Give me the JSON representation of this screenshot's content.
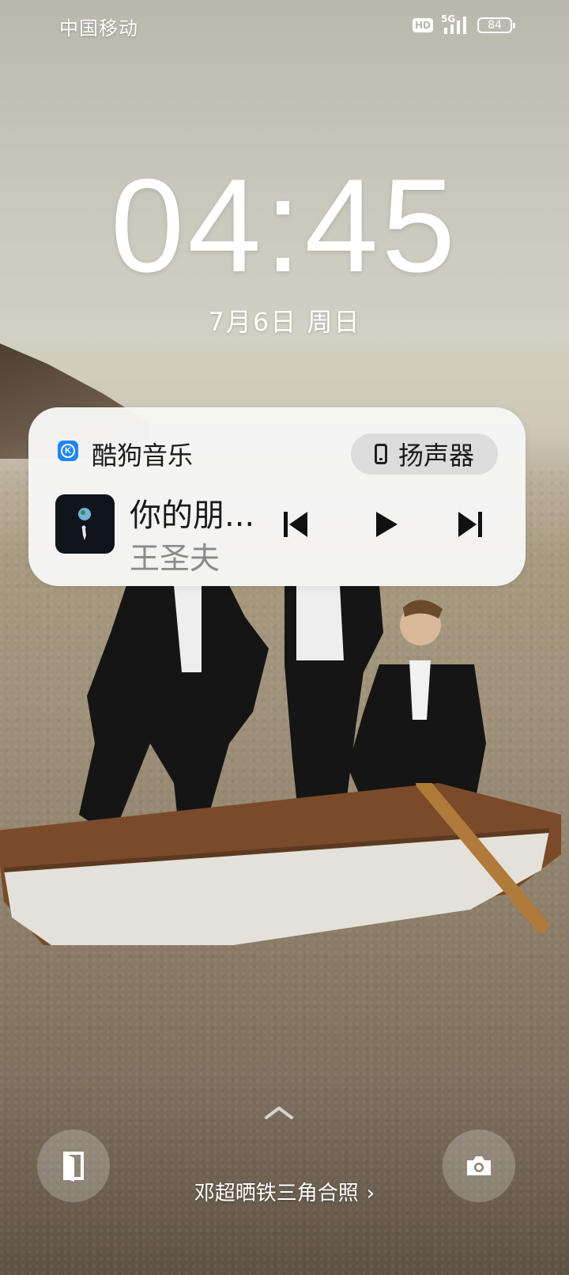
{
  "status_bar": {
    "carrier": "中国移动",
    "hd_label": "HD",
    "network_label": "5G",
    "battery_level": "84"
  },
  "lock_screen": {
    "time": "04:45",
    "date": "7月6日 周日"
  },
  "media_card": {
    "app_name": "酷狗音乐",
    "app_icon_letter": "K",
    "output_button_label": "扬声器",
    "song_title": "你的朋...",
    "artist": "王圣夫",
    "is_playing": false
  },
  "bottom": {
    "caption": "邓超晒铁三角合照",
    "caption_chevron": "›"
  },
  "colors": {
    "card_background": "#f6f6f6",
    "app_accent": "#1f86f3",
    "artist_text": "#8a8a8a",
    "speaker_button": "#dcdcdc"
  }
}
